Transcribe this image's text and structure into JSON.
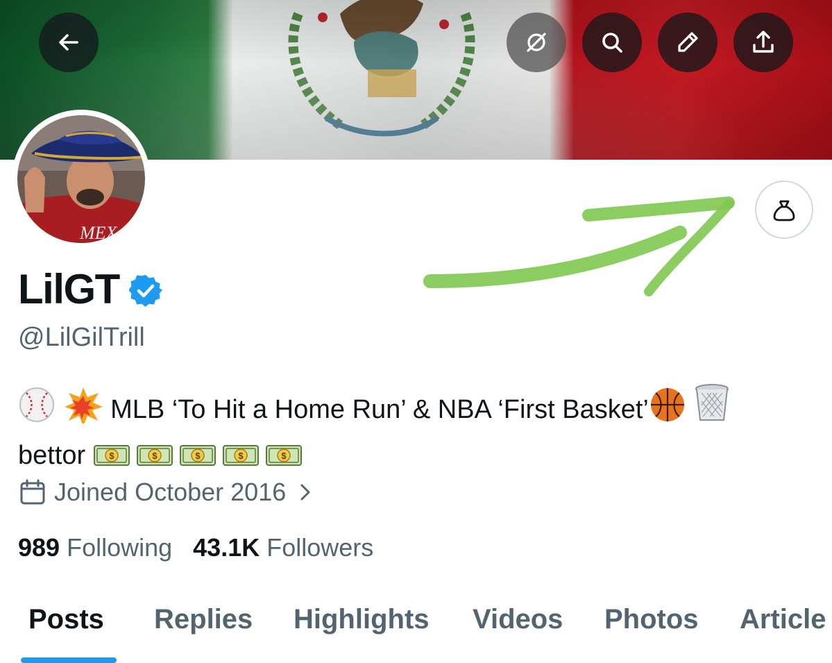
{
  "header": {
    "buttons": [
      {
        "name": "back-arrow-icon"
      },
      {
        "name": "grok-icon"
      },
      {
        "name": "search-icon"
      },
      {
        "name": "edit-icon"
      },
      {
        "name": "share-icon"
      }
    ]
  },
  "profile": {
    "display_name": "LilGT",
    "verified": true,
    "handle": "@LilGilTrill",
    "bio_text_1": "MLB ‘To Hit a Home Run’ & NBA ‘First Basket’",
    "bio_text_2": "bettor",
    "bio_emojis_start": [
      "baseball",
      "collision"
    ],
    "bio_emojis_end": [
      "basketball",
      "wastebasket"
    ],
    "bio_money_emojis": [
      "dollar-banknote",
      "dollar-banknote",
      "dollar-banknote",
      "dollar-banknote",
      "dollar-banknote"
    ],
    "joined": "Joined October 2016",
    "following_count": "989",
    "following_label": "Following",
    "followers_count": "43.1K",
    "followers_label": "Followers"
  },
  "actions": {
    "tip_icon": "money-bag-icon"
  },
  "annotation": {
    "color": "#7ec850"
  },
  "tabs": [
    {
      "label": "Posts",
      "active": true
    },
    {
      "label": "Replies",
      "active": false
    },
    {
      "label": "Highlights",
      "active": false
    },
    {
      "label": "Videos",
      "active": false
    },
    {
      "label": "Photos",
      "active": false
    },
    {
      "label": "Article",
      "active": false
    }
  ],
  "colors": {
    "accent": "#1d9bf0",
    "verified": "#1d9bf0",
    "muted_text": "#536471"
  }
}
